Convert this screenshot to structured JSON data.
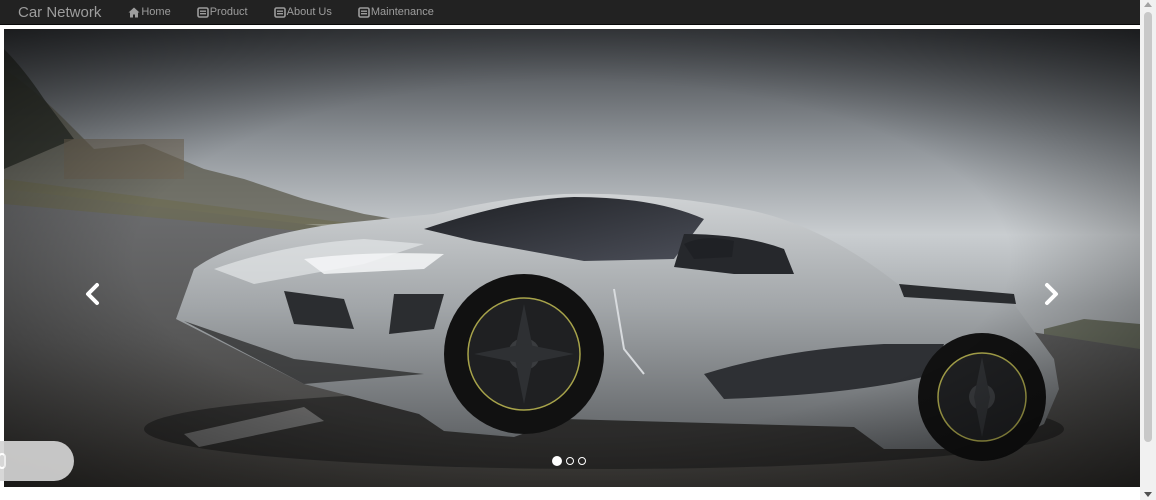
{
  "navbar": {
    "brand": "Car Network",
    "items": [
      {
        "label": "Home",
        "icon": "home-icon"
      },
      {
        "label": "Product",
        "icon": "panel-icon"
      },
      {
        "label": "About Us",
        "icon": "panel-icon"
      },
      {
        "label": "Maintenance",
        "icon": "panel-icon"
      }
    ]
  },
  "carousel": {
    "slide_count": 3,
    "active_slide": 1,
    "image": "silver-sports-car",
    "prev_icon": "chevron-left-icon",
    "next_icon": "chevron-right-icon"
  },
  "colors": {
    "navbar_bg": "#222222",
    "nav_text": "#9d9d9d",
    "car_silver": "#9fa3a6"
  }
}
